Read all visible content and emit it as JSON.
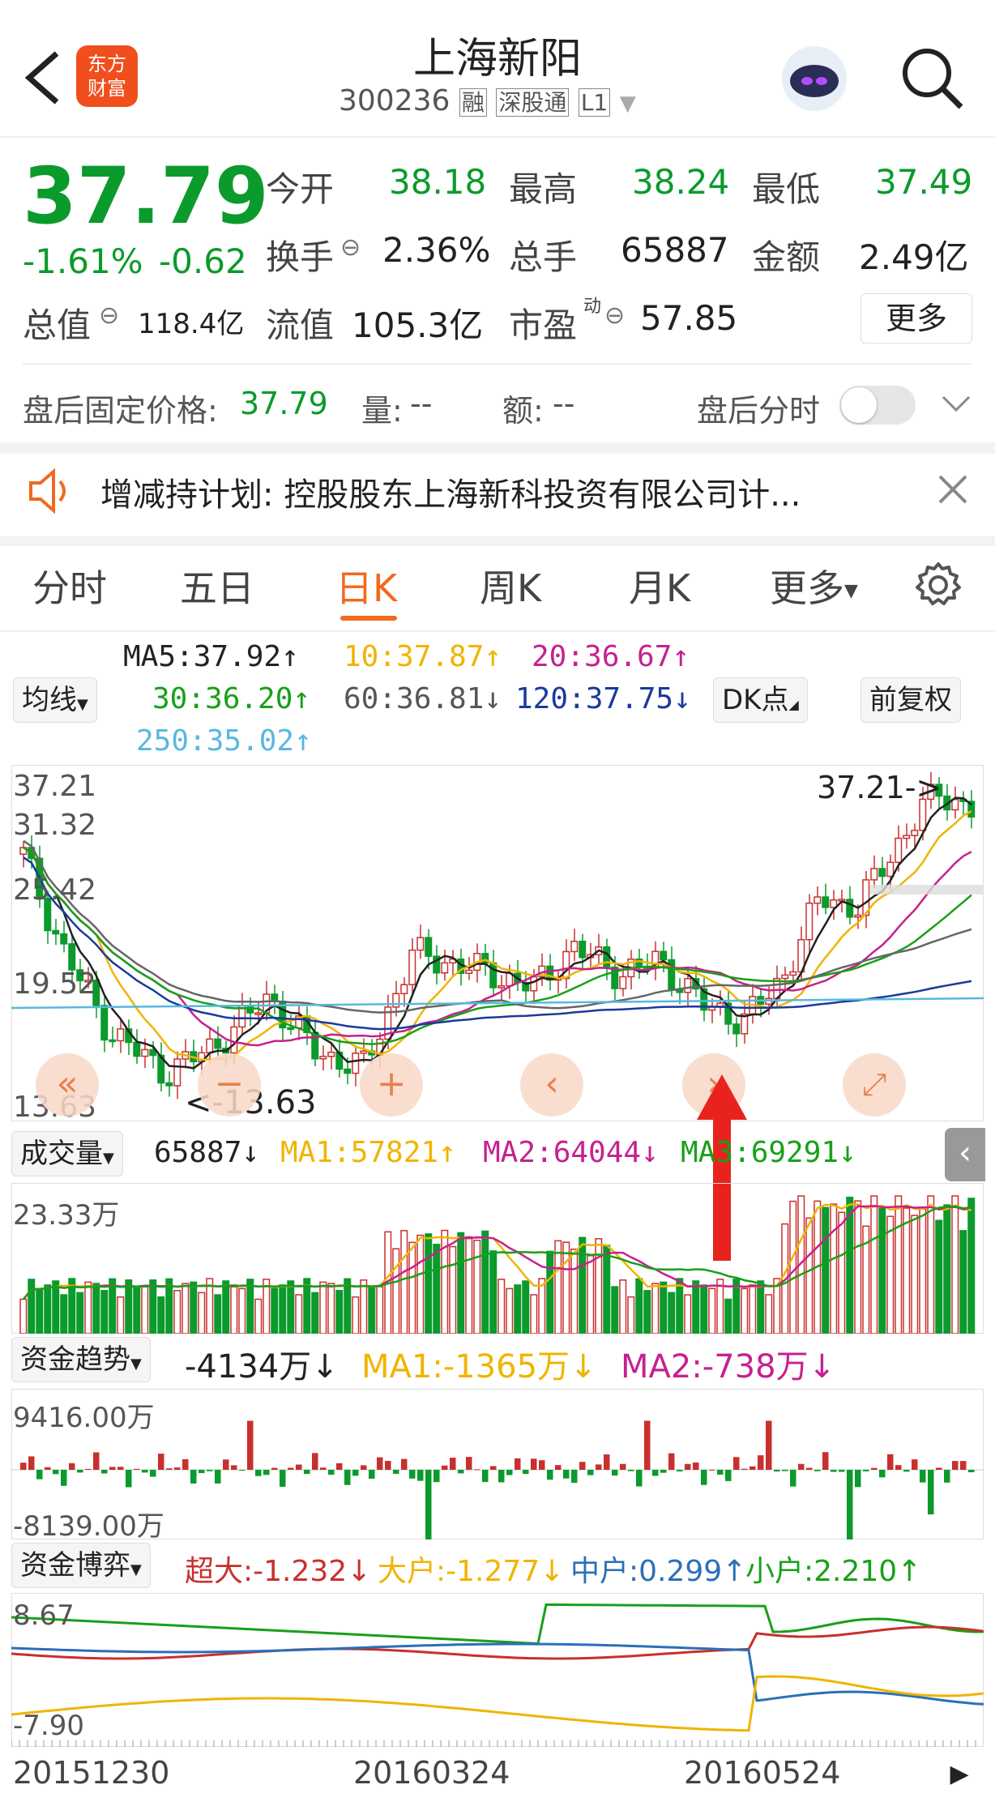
{
  "header": {
    "title": "上海新阳",
    "code": "300236",
    "tags": [
      "融",
      "深股通",
      "L1"
    ],
    "logo": [
      "东方",
      "财富"
    ]
  },
  "quote": {
    "price": "37.79",
    "pct": "-1.61%",
    "change": "-0.62",
    "fields": [
      {
        "k": "今开",
        "v": "38.18"
      },
      {
        "k": "最高",
        "v": "38.24"
      },
      {
        "k": "最低",
        "v": "37.49"
      },
      {
        "k": "换手",
        "v": "2.36%"
      },
      {
        "k": "总手",
        "v": "65887"
      },
      {
        "k": "金额",
        "v": "2.49亿"
      },
      {
        "k": "流值",
        "v": "105.3亿"
      },
      {
        "k": "市盈",
        "v": "57.85",
        "sup": "动"
      }
    ],
    "total_value_label": "总值",
    "total_value": "118.4亿",
    "more": "更多"
  },
  "after_hours": {
    "label": "盘后固定价格:",
    "price": "37.79",
    "vol_label": "量:",
    "vol": "--",
    "amt_label": "额:",
    "amt": "--",
    "toggle_label": "盘后分时",
    "toggle_on": false
  },
  "notice": {
    "text": "增减持计划:  控股股东上海新科投资有限公司计..."
  },
  "tabs": [
    "分时",
    "五日",
    "日K",
    "周K",
    "月K",
    "更多"
  ],
  "active_tab": "日K",
  "ma": {
    "selector": "均线",
    "ma5": "MA5:37.92↑",
    "ma10": "10:37.87↑",
    "ma20": "20:36.67↑",
    "ma30": "30:36.20↑",
    "ma60": "60:36.81↓",
    "ma120": "120:37.75↓",
    "ma250": "250:35.02↑",
    "dk": "DK点",
    "fq": "前复权"
  },
  "colors": {
    "up": "#c8302e",
    "down": "#0b9a2c",
    "accent": "#f06a1f",
    "ma5": "#222222",
    "ma10": "#f0b400",
    "ma20": "#c6218e",
    "ma30": "#18a018",
    "ma60": "#666666",
    "ma120": "#1a3a9c",
    "ma250": "#58b8e0",
    "arrow": "#e8231e"
  },
  "price_chart": {
    "y_labels": [
      "37.21",
      "31.32",
      "25.42",
      "19.52",
      "13.63"
    ],
    "max_label": "37.21->",
    "min_label": "<-13.63"
  },
  "volume": {
    "selector": "成交量",
    "value": "65887↓",
    "ma1": "MA1:57821↑",
    "ma2": "MA2:64044↓",
    "ma3": "MA3:69291↓",
    "y_label": "23.33万"
  },
  "fund_trend": {
    "selector": "资金趋势",
    "value": "-4134万↓",
    "ma1": "MA1:-1365万↓",
    "ma2": "MA2:-738万↓",
    "y_top": "9416.00万",
    "y_bottom": "-8139.00万"
  },
  "fund_game": {
    "selector": "资金博弈",
    "super": "超大:-1.232↓",
    "big": "大户:-1.277↓",
    "mid": "中户:0.299↑",
    "small": "小户:2.210↑",
    "y_top": "8.67",
    "y_bottom": "-7.90"
  },
  "dates": [
    "20151230",
    "20160324",
    "20160524"
  ],
  "icons": {
    "back": "back-arrow-icon",
    "search": "search-icon",
    "robot": "robot-avatar-icon",
    "speaker": "speaker-icon",
    "close": "close-icon",
    "gear": "gear-icon"
  }
}
